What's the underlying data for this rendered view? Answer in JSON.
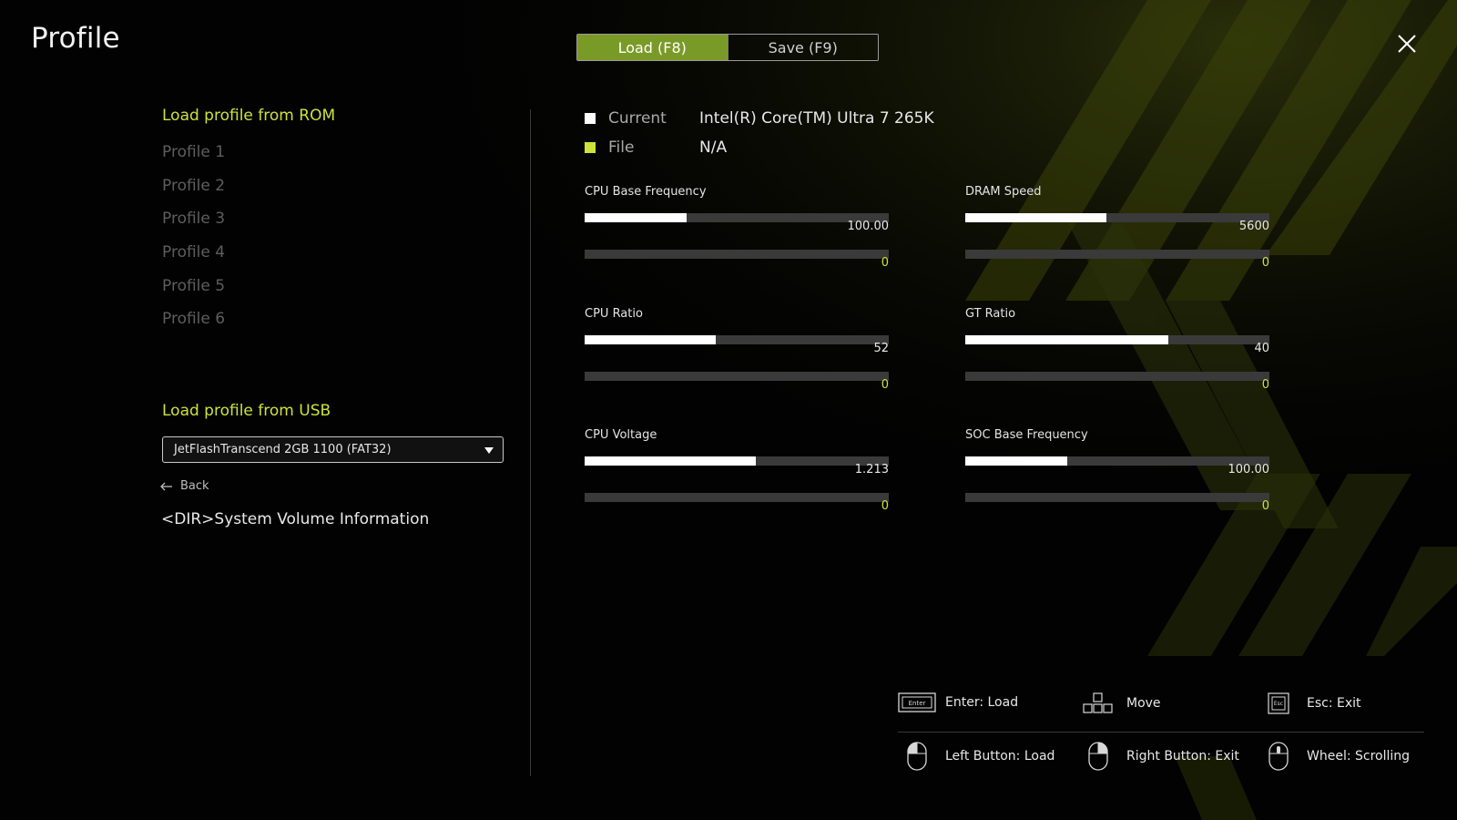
{
  "page": {
    "title": "Profile"
  },
  "tabs": [
    {
      "label": "Load (F8)",
      "active": true
    },
    {
      "label": "Save (F9)",
      "active": false
    }
  ],
  "theme": {
    "accent": "#cde23a",
    "tab_active_bg": "#7a9a28",
    "current_swatch": "#ffffff",
    "file_swatch": "#cde23a"
  },
  "rom": {
    "heading": "Load profile from ROM",
    "profiles": [
      "Profile 1",
      "Profile 2",
      "Profile 3",
      "Profile 4",
      "Profile 5",
      "Profile 6"
    ]
  },
  "usb": {
    "heading": "Load profile from USB",
    "selected_device": "JetFlashTranscend 2GB 1100 (FAT32)",
    "back_label": "Back",
    "entries": [
      "<DIR>System Volume Information"
    ]
  },
  "legend": {
    "current_label": "Current",
    "current_value": "Intel(R) Core(TM) Ultra 7 265K",
    "file_label": "File",
    "file_value": "N/A"
  },
  "metrics": [
    {
      "label": "CPU Base Frequency",
      "current": "100.00",
      "file": "0",
      "current_fraction": 0.335,
      "file_fraction": 0
    },
    {
      "label": "DRAM Speed",
      "current": "5600",
      "file": "0",
      "current_fraction": 0.465,
      "file_fraction": 0
    },
    {
      "label": "CPU Ratio",
      "current": "52",
      "file": "0",
      "current_fraction": 0.432,
      "file_fraction": 0
    },
    {
      "label": "GT Ratio",
      "current": "40",
      "file": "0",
      "current_fraction": 0.667,
      "file_fraction": 0
    },
    {
      "label": "CPU Voltage",
      "current": "1.213",
      "file": "0",
      "current_fraction": 0.563,
      "file_fraction": 0
    },
    {
      "label": "SOC Base Frequency",
      "current": "100.00",
      "file": "0",
      "current_fraction": 0.335,
      "file_fraction": 0
    }
  ],
  "hints": {
    "enter": "Enter: Load",
    "move": "Move",
    "esc": "Esc: Exit",
    "left_button": "Left Button: Load",
    "right_button": "Right Button: Exit",
    "wheel": "Wheel: Scrolling",
    "enter_key_text": "Enter",
    "esc_key_text": "Esc"
  }
}
